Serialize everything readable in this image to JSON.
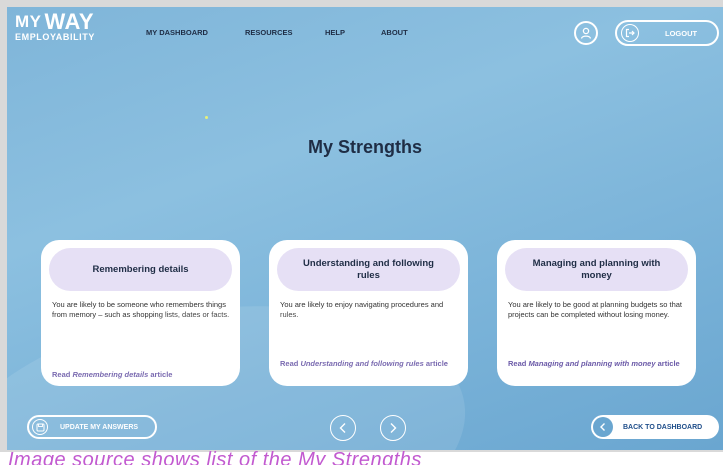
{
  "logo": {
    "line1_a": "MY",
    "line1_b": "WAY",
    "line2": "EMPLOYABILITY"
  },
  "nav": {
    "items": [
      {
        "label": "MY DASHBOARD"
      },
      {
        "label": "RESOURCES"
      },
      {
        "label": "HELP"
      },
      {
        "label": "ABOUT"
      }
    ]
  },
  "header": {
    "logout_label": "LOGOUT",
    "profile_icon": "user-icon",
    "logout_icon": "logout-icon"
  },
  "page": {
    "title": "My Strengths"
  },
  "cards": [
    {
      "heading": "Remembering details",
      "body": "You are likely to be someone who remembers things from memory – such as shopping lists, dates or facts.",
      "link_prefix": "Read ",
      "link_title": "Remembering details",
      "link_suffix": " article"
    },
    {
      "heading": "Understanding and following rules",
      "body": "You are likely to enjoy navigating procedures and rules.",
      "link_prefix": "Read ",
      "link_title": "Understanding and following rules",
      "link_suffix": " article"
    },
    {
      "heading": "Managing and planning with money",
      "body": "You are likely to be good at planning budgets so that projects can be completed without losing money.",
      "link_prefix": "Read ",
      "link_title": "Managing and planning with money",
      "link_suffix": " article"
    }
  ],
  "footer": {
    "update_label": "UPDATE MY ANSWERS",
    "back_label": "BACK TO DASHBOARD"
  },
  "caption": "Image source shows list of the My Strengths"
}
